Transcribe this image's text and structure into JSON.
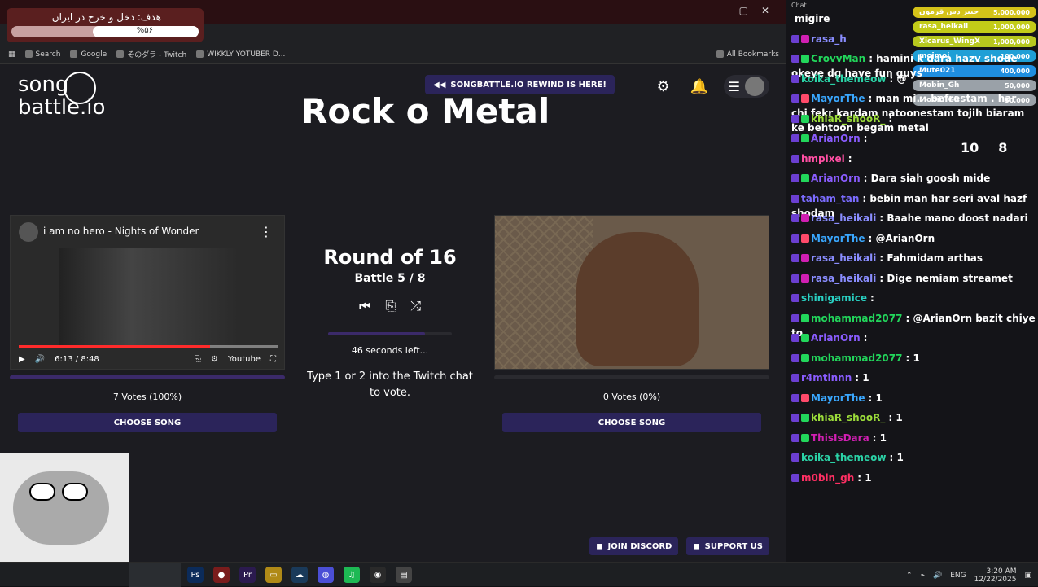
{
  "browser": {
    "donation_text": "هدف: دخل و خرج در ایران",
    "donation_percent": "%۵۶",
    "bookmarks": [
      "Search",
      "Google",
      "そのダラ - Twitch",
      "WIKKLY YOTUBER D..."
    ],
    "all_bookmarks": "All Bookmarks"
  },
  "site": {
    "logo_line1": "song",
    "logo_line2": "battle.io",
    "rewind_label": "SONGBATTLE.IO REWIND IS HERE!",
    "page_title": "Rock o Metal",
    "left_video_title": "i am no hero - Nights of Wonder",
    "left_time": "6:13 / 8:48",
    "left_platform": "Youtube",
    "round": "Round of 16",
    "battle": "Battle 5 / 8",
    "timer": "46 seconds left...",
    "instructions": "Type 1 or 2 into the Twitch chat to vote.",
    "left_votes": "7 Votes (100%)",
    "right_votes": "0 Votes (0%)",
    "choose_label": "CHOOSE SONG",
    "join_discord": "JOIN DISCORD",
    "support_us": "SUPPORT US"
  },
  "chat": {
    "title": "Chat",
    "leaderboard": [
      {
        "name": "جیبر دس قرمون",
        "value": "5,000,000",
        "color": "#d5c319"
      },
      {
        "name": "rasa_heikali",
        "value": "1,000,000",
        "color": "#c3cc18"
      },
      {
        "name": "Xicarus_WingX",
        "value": "1,000,000",
        "color": "#b7c81e"
      },
      {
        "name": "mojmoj",
        "value": "100,000",
        "color": "#1f9fd6"
      },
      {
        "name": "Mute021",
        "value": "400,000",
        "color": "#1f8ee0"
      },
      {
        "name": "Mobin_Gh",
        "value": "50,000",
        "color": "#9aa1a8"
      },
      {
        "name": "Mobin_Gh",
        "value": "50,000",
        "color": "#9aa1a8"
      }
    ],
    "stats": [
      "10",
      "8"
    ],
    "messages": [
      {
        "name": "",
        "text": "migire",
        "color": "#ffffff",
        "badges": []
      },
      {
        "name": "rasa_h",
        "text": "",
        "color": "#8a8dff",
        "badges": [
          "#6b3fd1",
          "#d11fb2"
        ]
      },
      {
        "name": "CrovvMan",
        "text": ": hamini k dara hazv shode okeye dg have fun guys",
        "color": "#22d65b",
        "badges": [
          "#6b3fd1",
          "#22d65b"
        ]
      },
      {
        "name": "koika_themeow",
        "text": ": @",
        "color": "#2bd2a6",
        "badges": [
          "#6b3fd1"
        ]
      },
      {
        "name": "MayorThe",
        "text": ": man mi... befrestam . har chi fekr kardam natoonestam tojih biaram ke behtoon begam metal",
        "color": "#3aa8ff",
        "badges": [
          "#6b3fd1",
          "#ff4a6a"
        ]
      },
      {
        "name": "khiaR_shooR_",
        "text": ":",
        "color": "#9cdd3a",
        "badges": [
          "#6b3fd1",
          "#22d65b"
        ]
      },
      {
        "name": "ArianOrn",
        "text": ":",
        "color": "#8a5cff",
        "badges": [
          "#6b3fd1",
          "#22d65b"
        ]
      },
      {
        "name": "hmpixel",
        "text": ":",
        "color": "#ff4fa3",
        "badges": [
          "#6b3fd1"
        ]
      },
      {
        "name": "ArianOrn",
        "text": ": Dara siah goosh mide",
        "color": "#8a5cff",
        "badges": [
          "#6b3fd1",
          "#22d65b"
        ]
      },
      {
        "name": "taham_tan",
        "text": ": bebin man har seri aval hazf shodam",
        "color": "#7b6cff",
        "badges": [
          "#6b3fd1"
        ]
      },
      {
        "name": "rasa_heikali",
        "text": ": Baahe mano doost nadari",
        "color": "#8a8dff",
        "badges": [
          "#6b3fd1",
          "#d11fb2"
        ]
      },
      {
        "name": "MayorThe",
        "text": ": @ArianOrn",
        "color": "#3aa8ff",
        "badges": [
          "#6b3fd1",
          "#ff4a6a"
        ]
      },
      {
        "name": "rasa_heikali",
        "text": ": Fahmidam arthas",
        "color": "#8a8dff",
        "badges": [
          "#6b3fd1",
          "#d11fb2"
        ]
      },
      {
        "name": "rasa_heikali",
        "text": ": Dige nemiam streamet",
        "color": "#8a8dff",
        "badges": [
          "#6b3fd1",
          "#d11fb2"
        ]
      },
      {
        "name": "shinigamice",
        "text": ":",
        "color": "#29d1c3",
        "badges": [
          "#6b3fd1"
        ]
      },
      {
        "name": "mohammad2077",
        "text": ": @ArianOrn bazit chiye to",
        "color": "#22d65b",
        "badges": [
          "#6b3fd1",
          "#22d65b"
        ]
      },
      {
        "name": "ArianOrn",
        "text": ":",
        "color": "#8a5cff",
        "badges": [
          "#6b3fd1",
          "#22d65b"
        ]
      },
      {
        "name": "mohammad2077",
        "text": ": 1",
        "color": "#22d65b",
        "badges": [
          "#6b3fd1",
          "#22d65b"
        ]
      },
      {
        "name": "r4mtinnn",
        "text": ": 1",
        "color": "#8a5cff",
        "badges": [
          "#6b3fd1"
        ]
      },
      {
        "name": "MayorThe",
        "text": ": 1",
        "color": "#3aa8ff",
        "badges": [
          "#6b3fd1",
          "#ff4a6a"
        ]
      },
      {
        "name": "khiaR_shooR_",
        "text": ": 1",
        "color": "#9cdd3a",
        "badges": [
          "#6b3fd1",
          "#22d65b"
        ]
      },
      {
        "name": "ThisIsDara",
        "text": ": 1",
        "color": "#d11fb2",
        "badges": [
          "#6b3fd1",
          "#22d65b"
        ]
      },
      {
        "name": "koika_themeow",
        "text": ": 1",
        "color": "#2bd2a6",
        "badges": [
          "#6b3fd1"
        ]
      },
      {
        "name": "m0bin_gh",
        "text": ": 1",
        "color": "#ff2f63",
        "badges": [
          "#6b3fd1"
        ]
      }
    ]
  },
  "taskbar": {
    "lang": "ENG",
    "time": "3:20 AM",
    "date": "12/22/2025"
  }
}
